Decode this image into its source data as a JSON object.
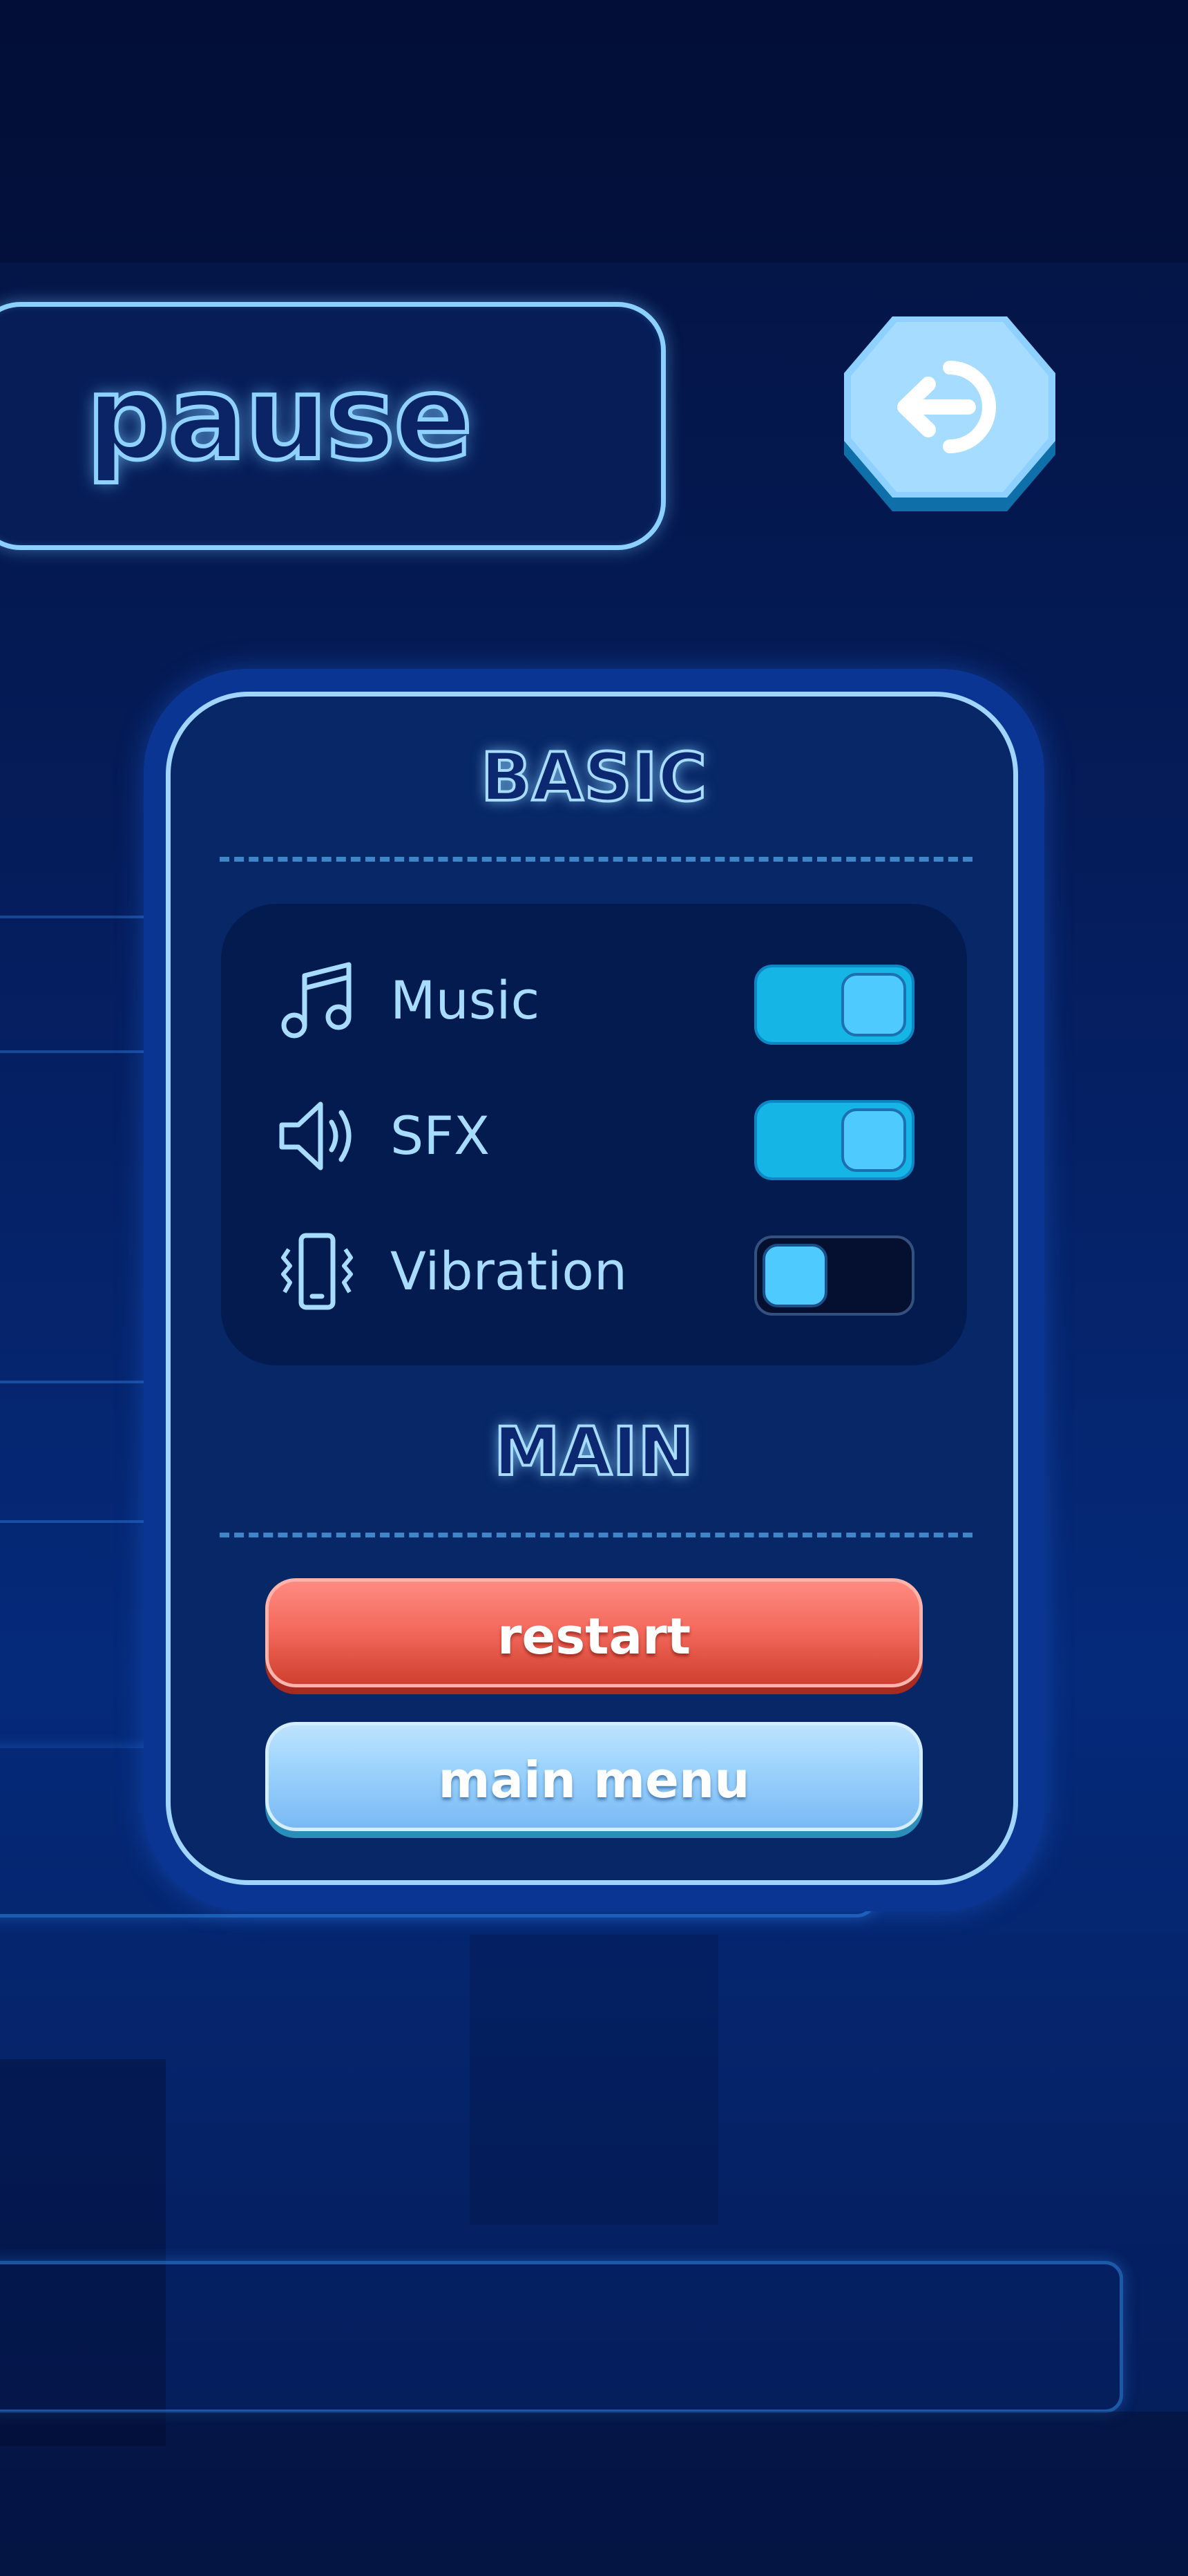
{
  "header": {
    "title": "pause",
    "back_button_icon": "back-arrow-icon"
  },
  "panel": {
    "basic_section": {
      "title": "BASIC",
      "settings": [
        {
          "icon": "music-note-icon",
          "label": "Music",
          "enabled": true
        },
        {
          "icon": "speaker-icon",
          "label": "SFX",
          "enabled": true
        },
        {
          "icon": "phone-vibration-icon",
          "label": "Vibration",
          "enabled": false
        }
      ]
    },
    "main_section": {
      "title": "MAIN",
      "restart_label": "restart",
      "main_menu_label": "main menu"
    }
  },
  "colors": {
    "background": "#051d5c",
    "accent": "#8fd2ff",
    "toggle_on": "#15b5e6",
    "restart": "#f46b5e",
    "main_menu": "#9ad2fc"
  }
}
